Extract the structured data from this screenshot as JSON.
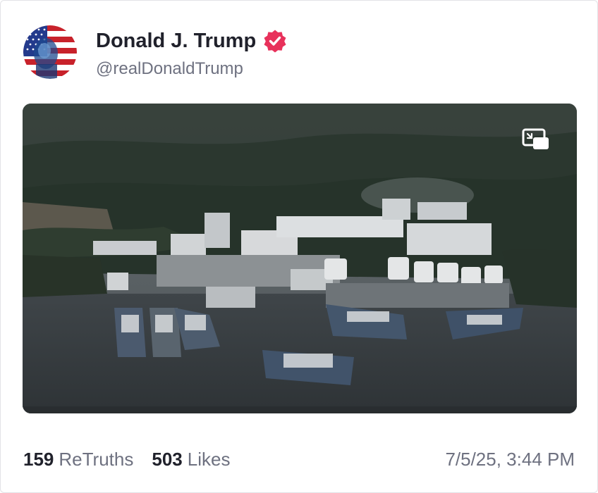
{
  "post": {
    "author": {
      "display_name": "Donald J. Trump",
      "handle": "@realDonaldTrump",
      "verified": true,
      "verified_color": "#e8315b",
      "avatar_icon": "flag-portrait-avatar"
    },
    "media": {
      "type": "video",
      "description_icon": "photo",
      "pip_icon": "picture-in-picture-icon"
    },
    "stats": {
      "retruths_count": "159",
      "retruths_label": "ReTruths",
      "likes_count": "503",
      "likes_label": "Likes"
    },
    "timestamp": "7/5/25, 3:44 PM"
  }
}
